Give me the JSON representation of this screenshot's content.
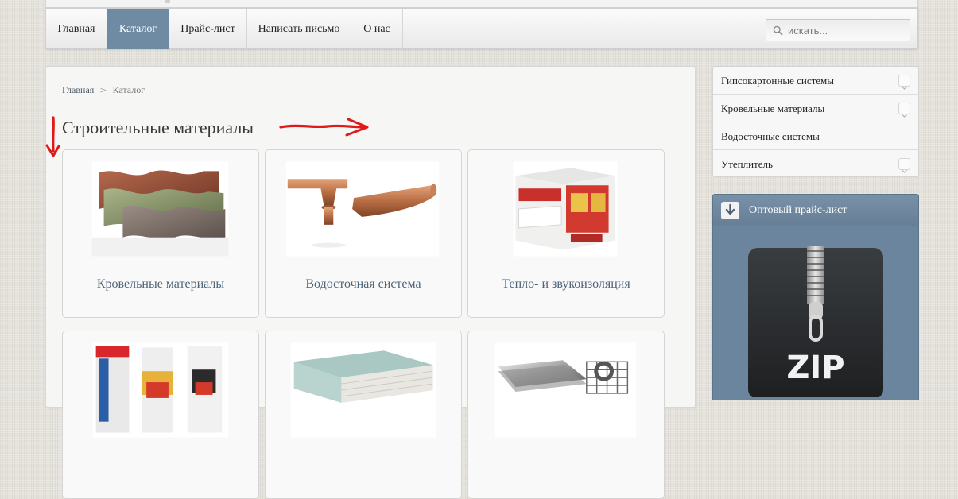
{
  "nav": {
    "items": [
      {
        "label": "Главная"
      },
      {
        "label": "Каталог",
        "active": true
      },
      {
        "label": "Прайс-лист"
      },
      {
        "label": "Написать письмо"
      },
      {
        "label": "О нас"
      }
    ],
    "search_placeholder": "искать..."
  },
  "breadcrumb": {
    "home": "Главная",
    "separator": ">",
    "current": "Каталог"
  },
  "page_title": "Строительные материалы",
  "cards": [
    {
      "label": "Кровельные материалы",
      "image": "roofing-tiles-image"
    },
    {
      "label": "Водосточная система",
      "image": "gutter-image"
    },
    {
      "label": "Тепло- и звукоизоляция",
      "image": "insulation-image"
    },
    {
      "label": "",
      "image": "dry-mix-bags-image"
    },
    {
      "label": "",
      "image": "drywall-sheets-image"
    },
    {
      "label": "",
      "image": "metal-sheets-image"
    }
  ],
  "sidebar": {
    "items": [
      {
        "label": "Гипсокартонные системы",
        "expandable": true
      },
      {
        "label": "Кровельные материалы",
        "expandable": true
      },
      {
        "label": "Водосточные системы",
        "expandable": false
      },
      {
        "label": "Утеплитель",
        "expandable": true
      }
    ]
  },
  "price_list": {
    "title": "Оптовый прайс-лист",
    "archive_label": "ZIP"
  },
  "colors": {
    "nav_active": "#6f8aa3",
    "accent_panel": "#6b859e",
    "annotation_red": "#e01a1a",
    "link": "#4e6478"
  }
}
